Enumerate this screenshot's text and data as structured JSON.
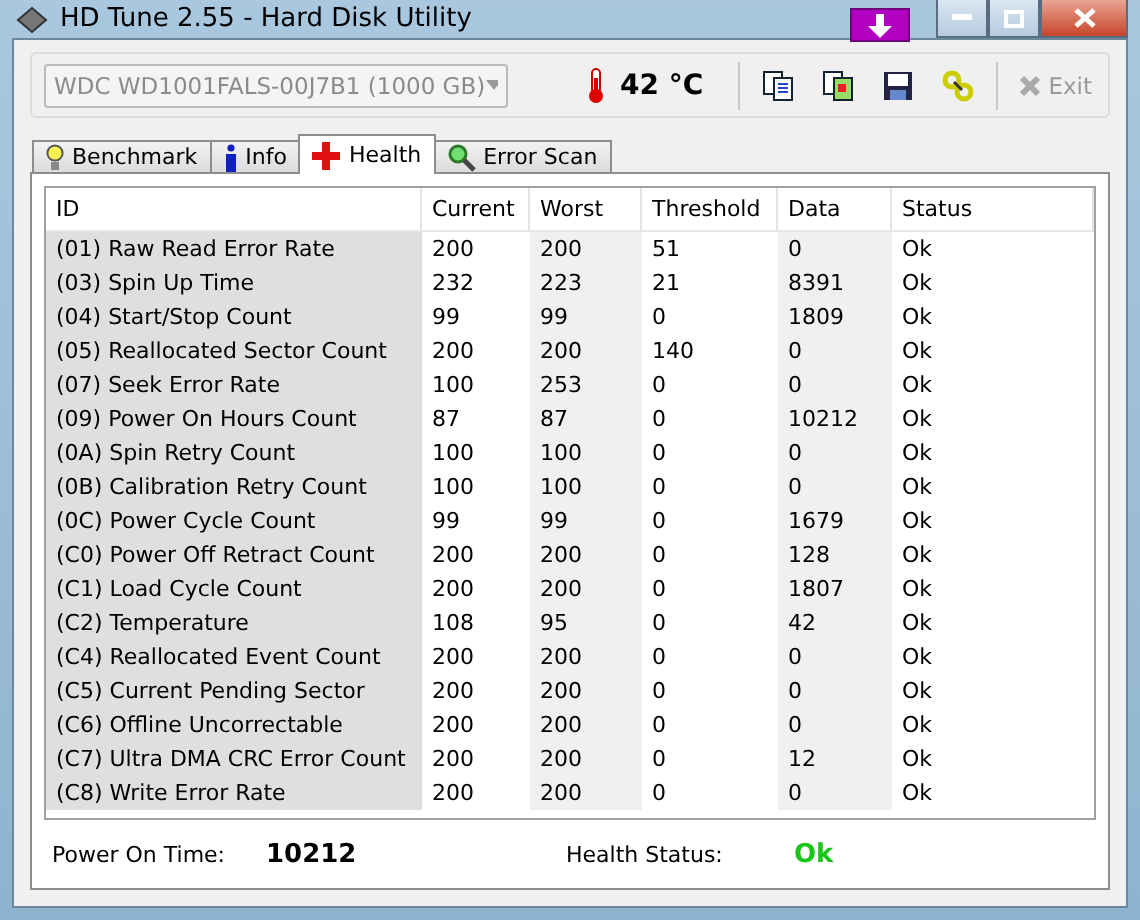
{
  "window": {
    "title": "HD Tune 2.55 - Hard Disk Utility"
  },
  "drive": {
    "value": "WDC WD1001FALS-00J7B1 (1000 GB)",
    "disabled": true
  },
  "temperature": "42 °C",
  "exit": {
    "label": "Exit",
    "disabled": true
  },
  "tabs": [
    {
      "label": "Benchmark",
      "selected": false
    },
    {
      "label": "Info",
      "selected": false
    },
    {
      "label": "Health",
      "selected": true
    },
    {
      "label": "Error Scan",
      "selected": false
    }
  ],
  "table": {
    "columns": [
      "ID",
      "Current",
      "Worst",
      "Threshold",
      "Data",
      "Status"
    ],
    "rows": [
      [
        "(01) Raw Read Error Rate",
        "200",
        "200",
        "51",
        "0",
        "Ok"
      ],
      [
        "(03) Spin Up Time",
        "232",
        "223",
        "21",
        "8391",
        "Ok"
      ],
      [
        "(04) Start/Stop Count",
        "99",
        "99",
        "0",
        "1809",
        "Ok"
      ],
      [
        "(05) Reallocated Sector Count",
        "200",
        "200",
        "140",
        "0",
        "Ok"
      ],
      [
        "(07) Seek Error Rate",
        "100",
        "253",
        "0",
        "0",
        "Ok"
      ],
      [
        "(09) Power On Hours Count",
        "87",
        "87",
        "0",
        "10212",
        "Ok"
      ],
      [
        "(0A) Spin Retry Count",
        "100",
        "100",
        "0",
        "0",
        "Ok"
      ],
      [
        "(0B) Calibration Retry Count",
        "100",
        "100",
        "0",
        "0",
        "Ok"
      ],
      [
        "(0C) Power Cycle Count",
        "99",
        "99",
        "0",
        "1679",
        "Ok"
      ],
      [
        "(C0) Power Off Retract Count",
        "200",
        "200",
        "0",
        "128",
        "Ok"
      ],
      [
        "(C1) Load Cycle Count",
        "200",
        "200",
        "0",
        "1807",
        "Ok"
      ],
      [
        "(C2) Temperature",
        "108",
        "95",
        "0",
        "42",
        "Ok"
      ],
      [
        "(C4) Reallocated Event Count",
        "200",
        "200",
        "0",
        "0",
        "Ok"
      ],
      [
        "(C5) Current Pending Sector",
        "200",
        "200",
        "0",
        "0",
        "Ok"
      ],
      [
        "(C6) Offline Uncorrectable",
        "200",
        "200",
        "0",
        "0",
        "Ok"
      ],
      [
        "(C7) Ultra DMA CRC Error Count",
        "200",
        "200",
        "0",
        "12",
        "Ok"
      ],
      [
        "(C8) Write Error Rate",
        "200",
        "200",
        "0",
        "0",
        "Ok"
      ]
    ]
  },
  "footer": {
    "power_on_label": "Power On Time:",
    "power_on_value": "10212",
    "health_label": "Health Status:",
    "health_value": "Ok"
  }
}
